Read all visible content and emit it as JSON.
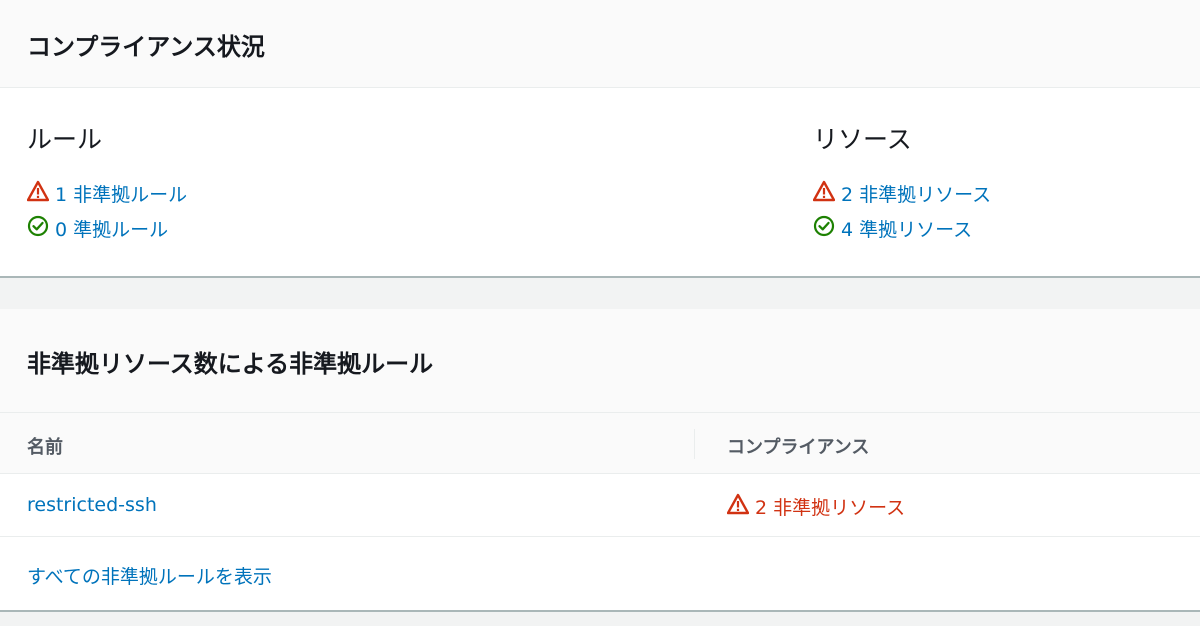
{
  "compliance_status": {
    "title": "コンプライアンス状況",
    "rules": {
      "heading": "ルール",
      "noncompliant": "1 非準拠ルール",
      "compliant": "0 準拠ルール"
    },
    "resources": {
      "heading": "リソース",
      "noncompliant": "2 非準拠リソース",
      "compliant": "4 準拠リソース"
    }
  },
  "noncompliant_rules": {
    "title": "非準拠リソース数による非準拠ルール",
    "columns": [
      "名前",
      "コンプライアンス"
    ],
    "rows": [
      {
        "name": "restricted-ssh",
        "compliance": "2 非準拠リソース"
      }
    ],
    "view_all": "すべての非準拠ルールを表示"
  },
  "colors": {
    "link": "#0073bb",
    "warning": "#d13212",
    "success": "#1d8102"
  },
  "icons": {
    "noncompliant": "warning-triangle-icon",
    "compliant": "check-circle-icon"
  }
}
